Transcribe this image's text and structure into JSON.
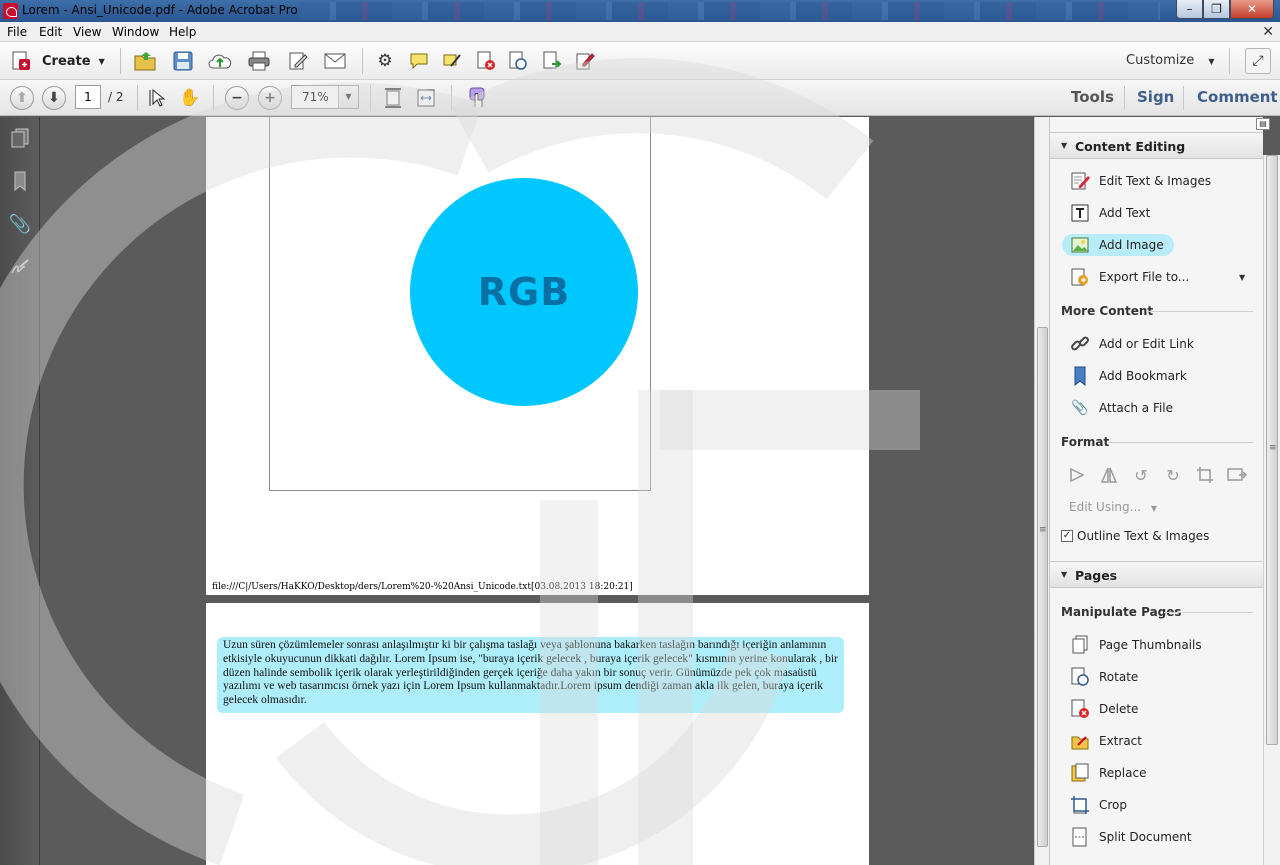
{
  "window": {
    "title": "Lorem - Ansi_Unicode.pdf - Adobe Acrobat Pro",
    "minimize": "–",
    "restore": "❐",
    "close": "✕"
  },
  "menu": [
    "File",
    "Edit",
    "View",
    "Window",
    "Help"
  ],
  "toolbar": {
    "create_label": "Create",
    "customize_label": "Customize"
  },
  "nav": {
    "current_page": "1",
    "page_total": "/ 2",
    "zoom": "71%"
  },
  "tabs": [
    "Tools",
    "Sign",
    "Comment"
  ],
  "document": {
    "circle_label": "RGB",
    "circle_color": "#00c8ff",
    "file_path": "file:///C|/Users/HaKKO/Desktop/ders/Lorem%20-%20Ansi_Unicode.txt[03.08.2013 18:20:21]",
    "paragraph": "Uzun süren çözümlemeler sonrası anlaşılmıştır ki bir çalışma taslağı veya şablonuna bakarken taslağın barındığı içeriğin anlamının etkisiyle okuyucunun dikkati dağılır. Lorem Ipsum ise, \"buraya içerik gelecek , buraya içerik gelecek\" kısmının yerine konularak , bir düzen halinde sembolik içerik olarak yerleştirildiğinden gerçek içeriğe daha yakın bir sonuç verir. Günümüzde pek çok masaüstü yazılımı ve web tasarımcısı örnek yazı için Lorem Ipsum kullanmaktadır.Lorem ipsum dendiği zaman akla ilk gelen, buraya içerik gelecek olmasıdır.",
    "highlight_color": "#aeeefa"
  },
  "panel": {
    "content_editing": {
      "title": "Content Editing",
      "items": [
        "Edit Text & Images",
        "Add Text",
        "Add Image",
        "Export File to..."
      ]
    },
    "more_content": {
      "title": "More Content",
      "items": [
        "Add or Edit Link",
        "Add Bookmark",
        "Attach a File"
      ]
    },
    "format": {
      "title": "Format",
      "edit_using": "Edit Using...",
      "outline_label": "Outline Text & Images",
      "outline_checked": true
    },
    "pages": {
      "title": "Pages",
      "manipulate_title": "Manipulate Pages",
      "items": [
        "Page Thumbnails",
        "Rotate",
        "Delete",
        "Extract",
        "Replace",
        "Crop",
        "Split Document"
      ]
    }
  }
}
